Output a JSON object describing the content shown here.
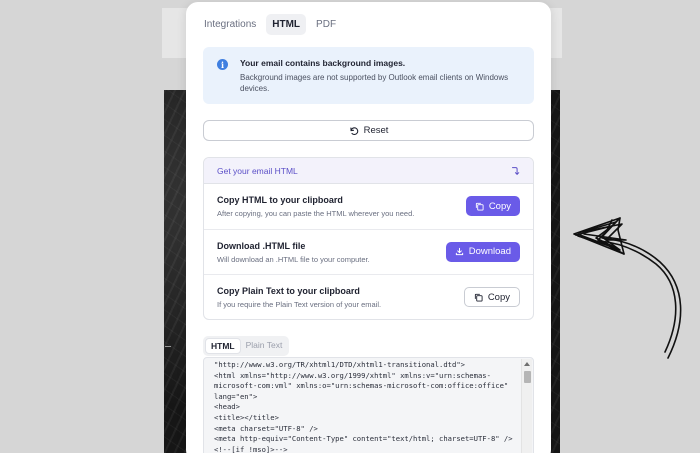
{
  "tabs": [
    {
      "label": "Integrations",
      "active": false
    },
    {
      "label": "HTML",
      "active": true
    },
    {
      "label": "PDF",
      "active": false
    }
  ],
  "notice": {
    "icon": "info-icon",
    "title": "Your email contains background images.",
    "body": "Background images are not supported by Outlook email clients on Windows devices."
  },
  "reset": {
    "label": "Reset",
    "icon": "reset-icon"
  },
  "email_section": {
    "title": "Get your email HTML",
    "toggle_icon": "arrow-curve-icon",
    "rows": [
      {
        "title": "Copy HTML to your clipboard",
        "description": "After copying, you can paste the HTML wherever you need.",
        "button": "Copy",
        "button_icon": "copy-icon"
      },
      {
        "title": "Download .HTML file",
        "description": "Will download an .HTML file to your computer.",
        "button": "Download",
        "button_icon": "download-icon"
      },
      {
        "title": "Copy Plain Text to your clipboard",
        "description": "If you require the Plain Text version of your email.",
        "button": "Copy",
        "button_icon": "copy-icon"
      }
    ]
  },
  "code_tabs": [
    {
      "label": "HTML",
      "active": true
    },
    {
      "label": "Plain Text",
      "active": false
    }
  ],
  "code_lines": [
    "\"http://www.w3.org/TR/xhtml1/DTD/xhtml1-transitional.dtd\">",
    "<html xmlns=\"http://www.w3.org/1999/xhtml\" xmlns:v=\"urn:schemas-",
    "microsoft-com:vml\" xmlns:o=\"urn:schemas-microsoft-com:office:office\"",
    "lang=\"en\">",
    "<head>",
    "<title></title>",
    "<meta charset=\"UTF-8\" />",
    "<meta http-equiv=\"Content-Type\" content=\"text/html; charset=UTF-8\" />",
    "<!--[if !mso]>-->"
  ],
  "colors": {
    "accent": "#6a5be8",
    "notice_bg": "#eaf2fc",
    "section_title": "#5b4fc7"
  }
}
